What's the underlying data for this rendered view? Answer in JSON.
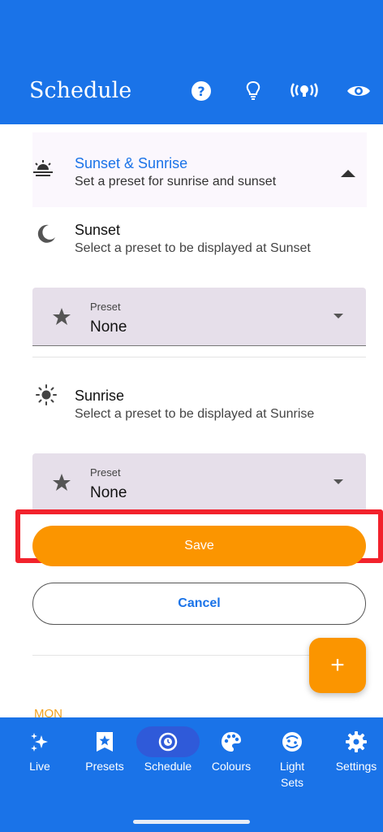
{
  "header": {
    "title": "Schedule",
    "icons": [
      "help-icon",
      "bulb-icon",
      "broadcast-icon",
      "eye-icon"
    ],
    "color": "#1a73e8"
  },
  "section": {
    "title": "Sunset & Sunrise",
    "subtitle": "Set a preset for sunrise and sunset"
  },
  "sunset": {
    "title": "Sunset",
    "description": "Select a preset to be displayed at Sunset",
    "dropdown": {
      "label": "Preset",
      "value": "None"
    }
  },
  "sunrise": {
    "title": "Sunrise",
    "description": "Select a preset to be displayed at Sunrise",
    "dropdown": {
      "label": "Preset",
      "value": "None"
    }
  },
  "actions": {
    "save_label": "Save",
    "cancel_label": "Cancel",
    "fab_label": "+",
    "accent": "#fb9500",
    "highlight": "#f2222c"
  },
  "list": {
    "day_label": "MON"
  },
  "bottom_nav": {
    "items": [
      {
        "label": "Live",
        "icon": "sparkles-icon"
      },
      {
        "label": "Presets",
        "icon": "star-bookmark-icon"
      },
      {
        "label": "Schedule",
        "icon": "schedule-clock-icon",
        "active": true
      },
      {
        "label": "Colours",
        "icon": "palette-icon"
      },
      {
        "label": "Light Sets",
        "icon": "light-sets-icon"
      },
      {
        "label": "Settings",
        "icon": "gear-icon"
      }
    ]
  }
}
